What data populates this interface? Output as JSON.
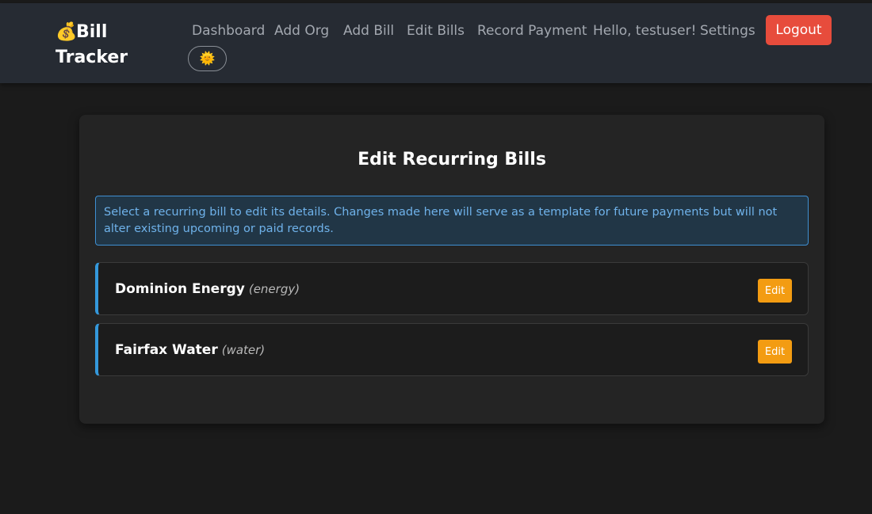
{
  "brand": {
    "icon": "money-bag-icon",
    "glyph": "💰",
    "line1": "Bill",
    "line2": "Tracker"
  },
  "nav": {
    "dashboard": "Dashboard",
    "add_org": "Add Org",
    "add_bill": "Add Bill",
    "edit_bills": "Edit Bills",
    "record_payment": "Record Payment",
    "greeting": "Hello, testuser!",
    "settings": "Settings",
    "logout": "Logout",
    "theme_toggle_icon": "sun-icon",
    "theme_toggle_glyph": "🌞"
  },
  "page": {
    "title": "Edit Recurring Bills",
    "info": "Select a recurring bill to edit its details. Changes made here will serve as a template for future payments but will not alter existing upcoming or paid records."
  },
  "bills": [
    {
      "name": "Dominion Energy",
      "category": "(energy)",
      "action": "Edit"
    },
    {
      "name": "Fairfax Water",
      "category": "(water)",
      "action": "Edit"
    }
  ],
  "colors": {
    "background": "#1b1b1b",
    "navbar": "#262b33",
    "card": "#242424",
    "logout": "#e74c3c",
    "edit": "#f39c12",
    "accent": "#3498db",
    "info_text": "#6fb2ea"
  }
}
